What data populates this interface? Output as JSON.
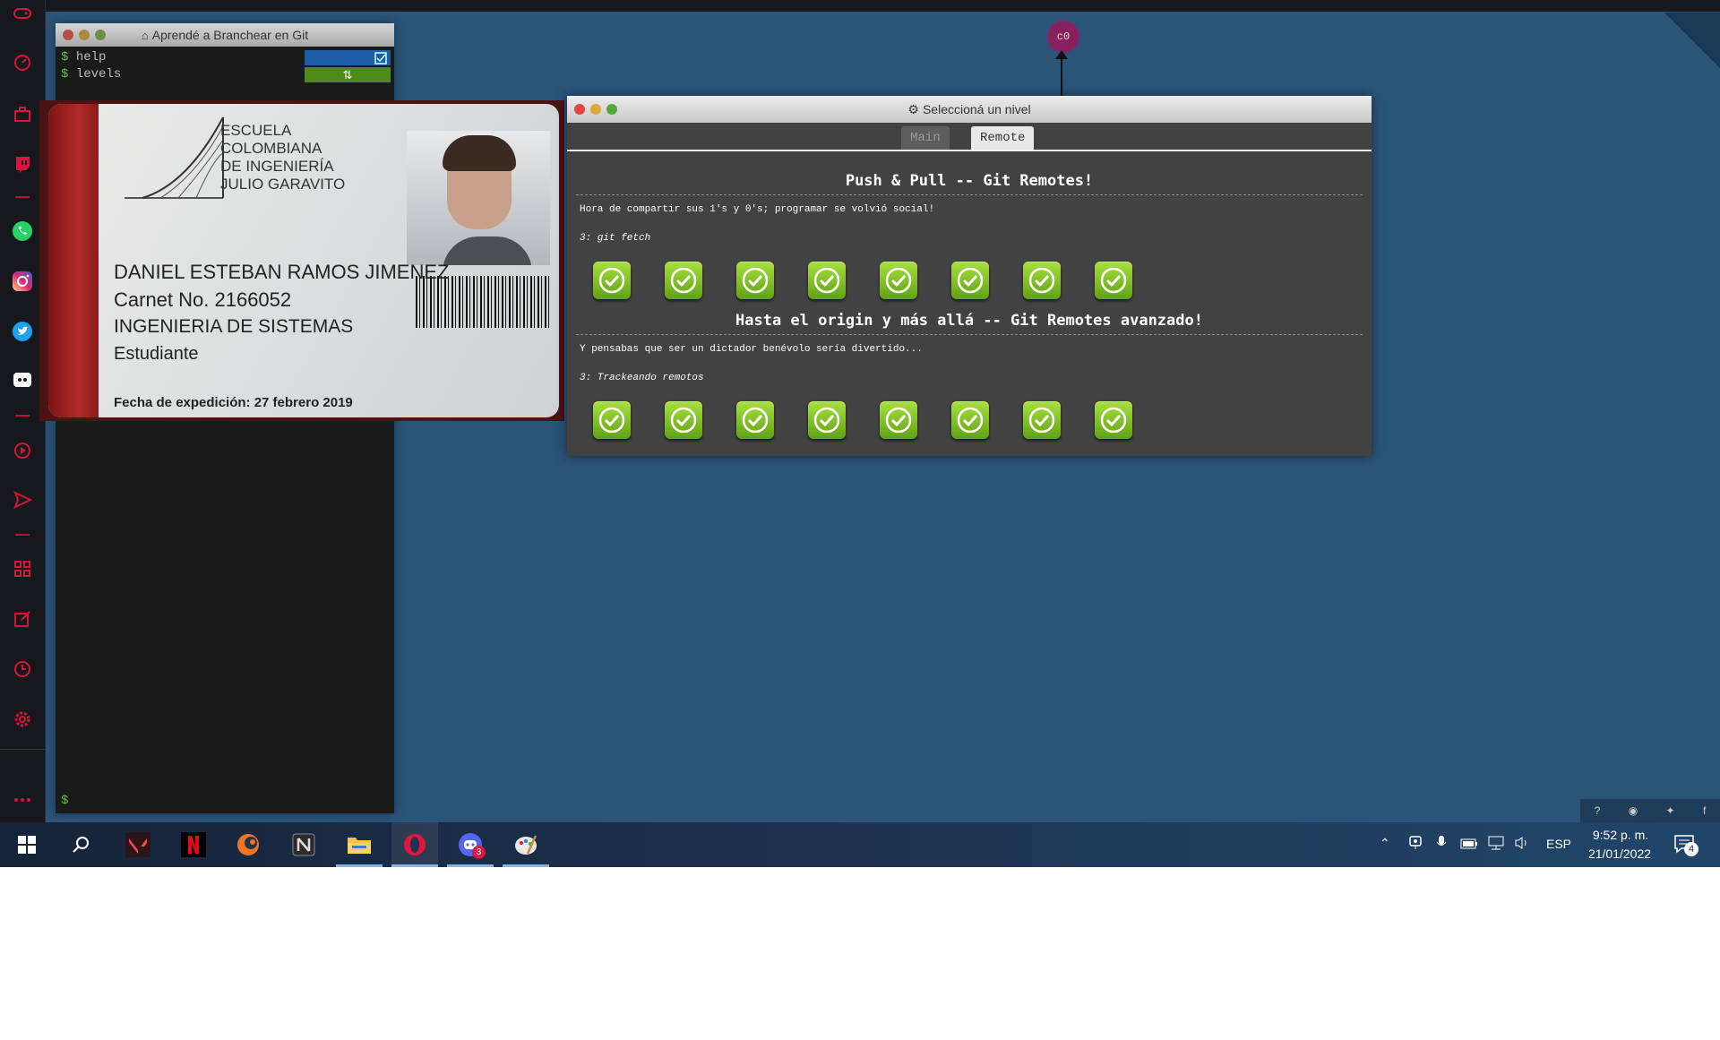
{
  "terminal": {
    "title": "Aprendé a Branchear en Git",
    "prompt": "$",
    "commands": [
      "help",
      "levels"
    ],
    "bottom_prompt": "$"
  },
  "id_card": {
    "school_lines": [
      "ESCUELA",
      "COLOMBIANA",
      "DE INGENIERÍA",
      "JULIO GARAVITO"
    ],
    "name": "DANIEL ESTEBAN RAMOS JIMENEZ",
    "carnet": "Carnet No. 2166052",
    "program": "INGENIERIA DE SISTEMAS",
    "role": "Estudiante",
    "issued": "Fecha de expedición: 27 febrero 2019"
  },
  "canvas": {
    "commit_label": "c0"
  },
  "level_dialog": {
    "title": "Seleccioná un nivel",
    "tabs": [
      {
        "label": "Main",
        "active": false
      },
      {
        "label": "Remote",
        "active": true
      }
    ],
    "sequences": [
      {
        "title": "Push & Pull -- Git Remotes!",
        "about": "Hora de compartir sus 1's y 0's; programar se volvió social!",
        "level_label": "3: git fetch",
        "levels_completed": 8
      },
      {
        "title": "Hasta el origin y más allá -- Git Remotes avanzado!",
        "about": "Y pensabas que ser un dictador benévolo sería divertido...",
        "level_label": "3: Trackeando remotos",
        "levels_completed": 8
      }
    ]
  },
  "sidebar_icons": [
    "gamepad-icon",
    "speedometer-icon",
    "briefcase-icon",
    "twitch-icon",
    "whatsapp-icon",
    "instagram-icon",
    "twitter-icon",
    "discord-icon",
    "player-icon",
    "send-icon",
    "grid-icon",
    "edit-icon",
    "clock-icon",
    "settings-icon",
    "more-icon"
  ],
  "taskbar": {
    "apps": [
      "valorant",
      "netflix",
      "crunchyroll",
      "notion",
      "file-explorer",
      "opera",
      "discord",
      "paint"
    ],
    "discord_badge": "3",
    "language": "ESP",
    "time": "9:52 p. m.",
    "date": "21/01/2022",
    "notification_count": "4"
  },
  "colors": {
    "desktop": "#2b5479",
    "level_done": "#7ec62a",
    "opera_red": "#e0163f"
  }
}
